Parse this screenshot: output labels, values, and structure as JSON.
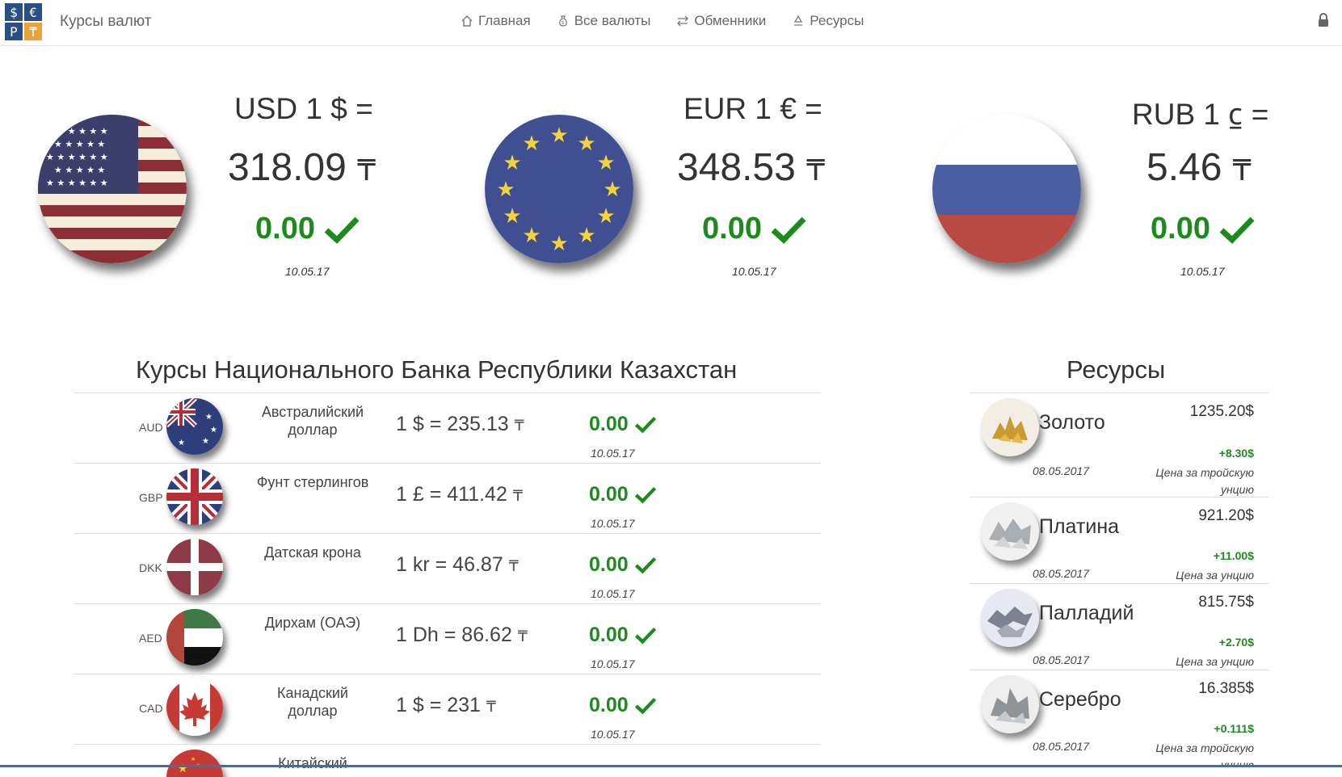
{
  "logo": {
    "c1": "$",
    "c2": "€",
    "c3": "Р",
    "c4": "₸"
  },
  "brand": "Курсы валют",
  "nav": [
    {
      "label": "Главная",
      "icon": "home-icon"
    },
    {
      "label": "Все валюты",
      "icon": "money-bag-icon"
    },
    {
      "label": "Обменники",
      "icon": "exchange-icon"
    },
    {
      "label": "Ресурсы",
      "icon": "recycle-icon"
    }
  ],
  "hero": [
    {
      "title": "USD 1 $ =",
      "value": "318.09",
      "tenge": "₸",
      "change": "0.00",
      "date": "10.05.17",
      "flag": "us-flag"
    },
    {
      "title": "EUR 1 € =",
      "value": "348.53",
      "tenge": "₸",
      "change": "0.00",
      "date": "10.05.17",
      "flag": "eu-flag"
    },
    {
      "title": "RUB 1 ⃀ =",
      "value": "5.46",
      "tenge": "₸",
      "change": "0.00",
      "date": "10.05.17",
      "flag": "ru-flag"
    }
  ],
  "nbrk": {
    "title": "Курсы Национального Банка Республики Казахстан",
    "rows": [
      {
        "code": "AUD",
        "name": "Австралийский доллар",
        "rate": "1 $ = 235.13",
        "tenge": "₸",
        "change": "0.00",
        "date": "10.05.17",
        "flag": "au-flag"
      },
      {
        "code": "GBP",
        "name": "Фунт стерлингов",
        "rate": "1 £ = 411.42",
        "tenge": "₸",
        "change": "0.00",
        "date": "10.05.17",
        "flag": "gb-flag"
      },
      {
        "code": "DKK",
        "name": "Датская крона",
        "rate": "1 kr = 46.87",
        "tenge": "₸",
        "change": "0.00",
        "date": "10.05.17",
        "flag": "dk-flag"
      },
      {
        "code": "AED",
        "name": "Дирхам (ОАЭ)",
        "rate": "1 Dh = 86.62",
        "tenge": "₸",
        "change": "0.00",
        "date": "10.05.17",
        "flag": "ae-flag"
      },
      {
        "code": "CAD",
        "name": "Канадский доллар",
        "rate": "1 $ = 231",
        "tenge": "₸",
        "change": "0.00",
        "date": "10.05.17",
        "flag": "ca-flag"
      },
      {
        "code": "",
        "name": "Китайский",
        "rate": "",
        "tenge": "",
        "change": "",
        "date": "",
        "flag": "cn-flag"
      }
    ]
  },
  "resources": {
    "title": "Ресурсы",
    "items": [
      {
        "name": "Золото",
        "price": "1235.20$",
        "change": "+8.30$",
        "date": "08.05.2017",
        "note": "Цена за тройскую унцию",
        "image": "gold-image"
      },
      {
        "name": "Платина",
        "price": "921.20$",
        "change": "+11.00$",
        "date": "08.05.2017",
        "note": "Цена за унцию",
        "image": "platinum-image"
      },
      {
        "name": "Палладий",
        "price": "815.75$",
        "change": "+2.70$",
        "date": "08.05.2017",
        "note": "Цена за унцию",
        "image": "palladium-image"
      },
      {
        "name": "Серебро",
        "price": "16.385$",
        "change": "+0.111$",
        "date": "08.05.2017",
        "note": "Цена за тройскую унцию",
        "image": "silver-image"
      }
    ]
  },
  "colors": {
    "accent_green": "#1c8a1c",
    "logo_blue": "#2a4f86",
    "logo_orange": "#e8a33a"
  }
}
